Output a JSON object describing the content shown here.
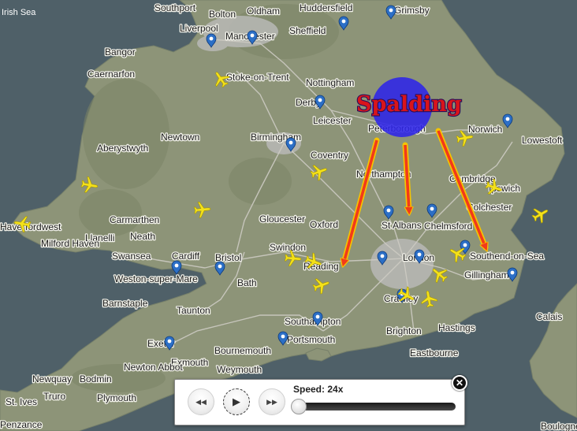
{
  "map": {
    "sea_labels": [
      "Irish Sea"
    ],
    "places": [
      {
        "name": "Southport"
      },
      {
        "name": "Bolton"
      },
      {
        "name": "Oldham"
      },
      {
        "name": "Huddersfield"
      },
      {
        "name": "Grimsby"
      },
      {
        "name": "Liverpool"
      },
      {
        "name": "Manchester"
      },
      {
        "name": "Sheffield"
      },
      {
        "name": "Bangor"
      },
      {
        "name": "Caernarfon"
      },
      {
        "name": "Stoke-on-Trent"
      },
      {
        "name": "Nottingham"
      },
      {
        "name": "Derby"
      },
      {
        "name": "Leicester"
      },
      {
        "name": "Peterborough"
      },
      {
        "name": "Norwich"
      },
      {
        "name": "Lowestoft"
      },
      {
        "name": "Newtown"
      },
      {
        "name": "Aberystwyth"
      },
      {
        "name": "Birmingham"
      },
      {
        "name": "Coventry"
      },
      {
        "name": "Northampton"
      },
      {
        "name": "Cambridge"
      },
      {
        "name": "Ipswich"
      },
      {
        "name": "Carmarthen"
      },
      {
        "name": "Haverfordwest"
      },
      {
        "name": "Llanelli"
      },
      {
        "name": "Neath"
      },
      {
        "name": "Milford Haven"
      },
      {
        "name": "Gloucester"
      },
      {
        "name": "Oxford"
      },
      {
        "name": "St Albans"
      },
      {
        "name": "Chelmsford"
      },
      {
        "name": "Colchester"
      },
      {
        "name": "Swansea"
      },
      {
        "name": "Cardiff"
      },
      {
        "name": "Bristol"
      },
      {
        "name": "Swindon"
      },
      {
        "name": "Reading"
      },
      {
        "name": "London"
      },
      {
        "name": "Southend-on-Sea"
      },
      {
        "name": "Gillingham"
      },
      {
        "name": "Weston-super-Mare"
      },
      {
        "name": "Bath"
      },
      {
        "name": "Barnstaple"
      },
      {
        "name": "Taunton"
      },
      {
        "name": "Crawley"
      },
      {
        "name": "Southampton"
      },
      {
        "name": "Portsmouth"
      },
      {
        "name": "Brighton"
      },
      {
        "name": "Hastings"
      },
      {
        "name": "Eastbourne"
      },
      {
        "name": "Calais"
      },
      {
        "name": "Exeter"
      },
      {
        "name": "Exmouth"
      },
      {
        "name": "Bournemouth"
      },
      {
        "name": "Weymouth"
      },
      {
        "name": "Newquay"
      },
      {
        "name": "Bodmin"
      },
      {
        "name": "Newton Abbot"
      },
      {
        "name": "Truro"
      },
      {
        "name": "Plymouth"
      },
      {
        "name": "St. Ives"
      },
      {
        "name": "Penzance"
      },
      {
        "name": "Boulogne"
      }
    ],
    "highlight": {
      "label": "Spalding",
      "circle_color": "#2d24e8",
      "arrow_color": "#f23a1a",
      "arrow_outline": "#f5c400"
    },
    "colors": {
      "land": "#8d9478",
      "water": "#4f6068",
      "road": "#c9c8c2",
      "urban": "#b9b9b6"
    },
    "icons": {
      "airport": "airport-marker-icon",
      "aircraft": "aircraft-icon"
    }
  },
  "playback": {
    "rewind_icon": "rewind-icon",
    "play_icon": "play-icon",
    "forward_icon": "fast-forward-icon",
    "speed_label": "Speed: 24x",
    "speed_value": 0,
    "close_icon": "close-icon"
  }
}
